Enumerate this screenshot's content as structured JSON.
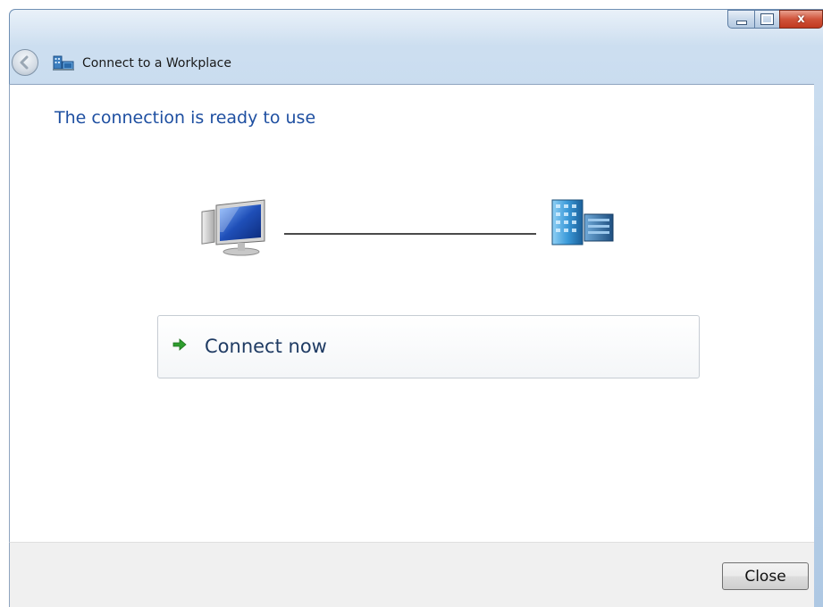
{
  "window": {
    "title": "Connect to a Workplace",
    "caption_buttons": {
      "minimize_glyph": "minimize-icon",
      "maximize_glyph": "maximize-icon",
      "close_glyph": "x"
    }
  },
  "content": {
    "heading": "The connection is ready to use",
    "diagram": {
      "left_icon": "computer-icon",
      "right_icon": "server-building-icon"
    },
    "command_link": {
      "label": "Connect now",
      "icon": "green-arrow-icon"
    }
  },
  "footer": {
    "close_label": "Close"
  },
  "colors": {
    "heading": "#1e4fa1",
    "frame": "#bcd3ea",
    "command_arrow": "#2e9e2e"
  }
}
